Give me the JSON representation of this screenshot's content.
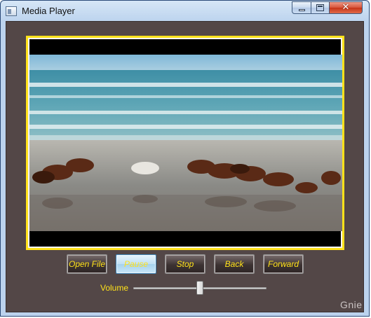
{
  "window": {
    "title": "Media Player",
    "close_glyph": "✕"
  },
  "player": {
    "video_content": "horses-galloping-on-beach"
  },
  "controls": {
    "buttons": [
      {
        "label": "Open File",
        "state": "normal"
      },
      {
        "label": "Pause",
        "state": "active"
      },
      {
        "label": "Stop",
        "state": "normal"
      },
      {
        "label": "Back",
        "state": "normal"
      },
      {
        "label": "Forward",
        "state": "normal"
      }
    ],
    "volume_label": "Volume",
    "volume_level": 0.5
  },
  "watermark": "Gnie",
  "colors": {
    "accent": "#ffe21a",
    "background": "#534747",
    "frame": "#ffe21a"
  },
  "icons": [
    "app-icon",
    "minimize-icon",
    "maximize-icon",
    "close-icon"
  ]
}
